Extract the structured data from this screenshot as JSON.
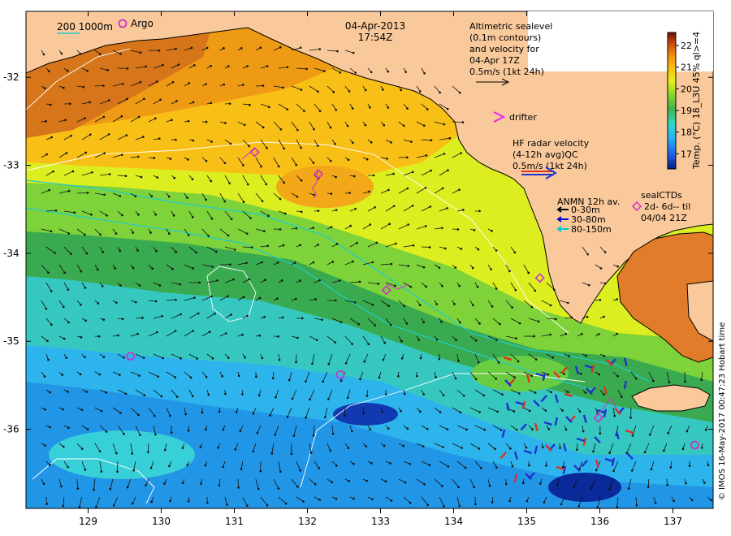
{
  "date": "04-Apr-2013",
  "time": "17:54Z",
  "scale_legend": {
    "values": "200  1000m",
    "argo": "Argo"
  },
  "altimetry": {
    "lines": [
      "Altimetric sealevel",
      "(0.1m contours)",
      "and velocity for",
      "04-Apr 17Z",
      "0.5m/s (1kt 24h)"
    ]
  },
  "drifter_label": "drifter",
  "hf_radar": {
    "lines": [
      "HF radar velocity",
      "(4-12h avg)QC",
      "0.5m/s (1kt 24h)"
    ]
  },
  "anmn": {
    "title": "ANMN 12h av.",
    "items": [
      {
        "label": "0-30m",
        "color": "#000000"
      },
      {
        "label": "30-80m",
        "color": "#0000cc"
      },
      {
        "label": "80-150m",
        "color": "#00cccc"
      }
    ]
  },
  "sealctds": {
    "title": "sealCTDs",
    "line1": "2d- 6d-- til",
    "line2": "04/04 21Z"
  },
  "colorbar": {
    "label": "Temp. (°C) 18_L3U 45% ql>=4",
    "ticks": [
      "17",
      "18",
      "19",
      "20",
      "21",
      "22"
    ],
    "min": 16.3,
    "max": 22.6
  },
  "credit": "© IMOS 16-May-2017 00:47:23 Hobart time",
  "axes": {
    "x_ticks": [
      "129",
      "130",
      "131",
      "132",
      "133",
      "134",
      "135",
      "136",
      "137"
    ],
    "x_values": [
      129,
      130,
      131,
      132,
      133,
      134,
      135,
      136,
      137
    ],
    "y_ticks": [
      "-32",
      "-33",
      "-34",
      "-35",
      "-36"
    ],
    "y_values": [
      -32,
      -33,
      -34,
      -35,
      -36
    ],
    "lon_range": [
      128.15,
      137.55
    ],
    "lat_range": [
      -36.9,
      -31.25
    ]
  },
  "colors": {
    "land": "#f9c99b",
    "argo": "#cc33cc",
    "hf_radar_blue": "#1f33cc",
    "hf_radar_red": "#e03020",
    "isobath_200": "#22cccc",
    "isobath_1000": "#e8f0e8"
  },
  "argo_floats": [
    {
      "lon": 129.58,
      "lat": -35.17
    },
    {
      "lon": 132.45,
      "lat": -35.38
    },
    {
      "lon": 137.3,
      "lat": -36.18
    }
  ],
  "seal_ctds": [
    {
      "lon": 131.28,
      "lat": -32.85
    },
    {
      "lon": 132.15,
      "lat": -33.1
    },
    {
      "lon": 133.08,
      "lat": -34.42
    },
    {
      "lon": 135.18,
      "lat": -34.28
    },
    {
      "lon": 135.98,
      "lat": -35.87
    }
  ]
}
